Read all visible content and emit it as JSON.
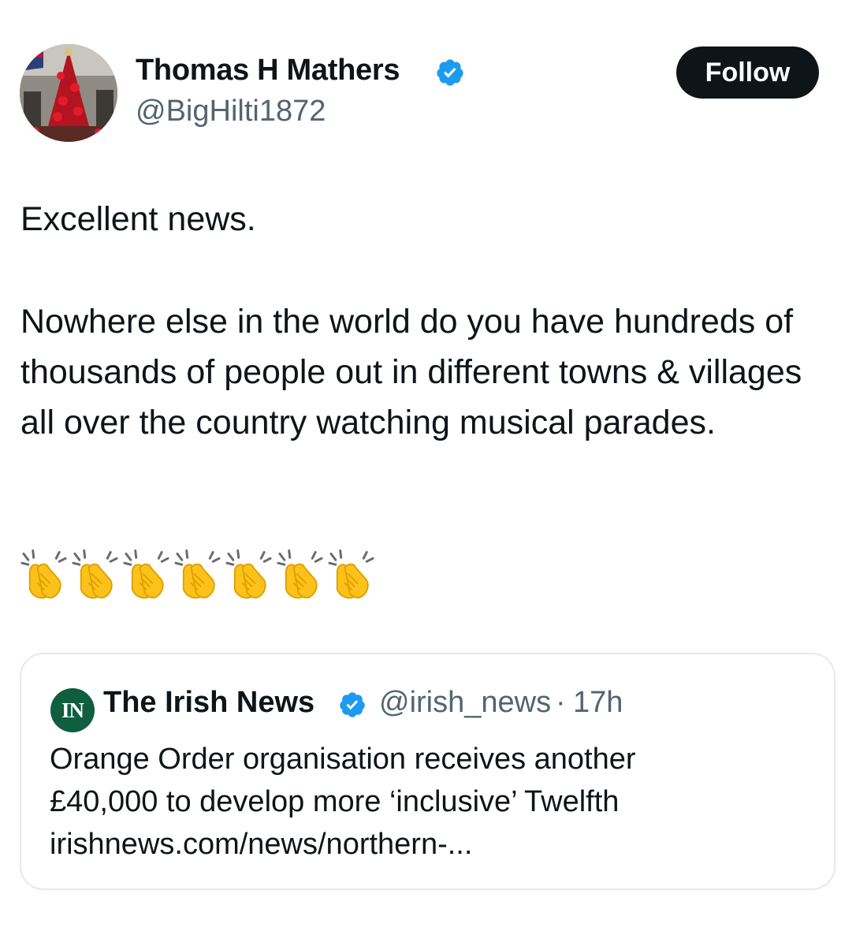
{
  "author": {
    "display_name": "Thomas H Mathers",
    "handle": "@BigHilti1872",
    "verified": true
  },
  "follow_button": {
    "label": "Follow"
  },
  "tweet": {
    "paragraphs": [
      "Excellent news.",
      "Nowhere else in the world do you have hundreds of thousands of people out in different towns & villages all over the country watching musical parades."
    ],
    "emoji": {
      "name": "clapping-hands",
      "count": 7
    }
  },
  "quoted_tweet": {
    "logo_text": "IN",
    "display_name": "The Irish News",
    "handle": "@irish_news",
    "separator": "·",
    "time": "17h",
    "verified": true,
    "lines": [
      "Orange Order organisation receives another",
      "£40,000 to develop more ‘inclusive’ Twelfth",
      "irishnews.com/news/northern-..."
    ]
  },
  "colors": {
    "text": "#0f1419",
    "secondary": "#536471",
    "verified_blue": "#1d9bf0",
    "follow_bg": "#0f1419",
    "border": "#e6e9ec",
    "irish_news_green": "#0e5e3f",
    "clap_yellow": "#fcc21b"
  }
}
